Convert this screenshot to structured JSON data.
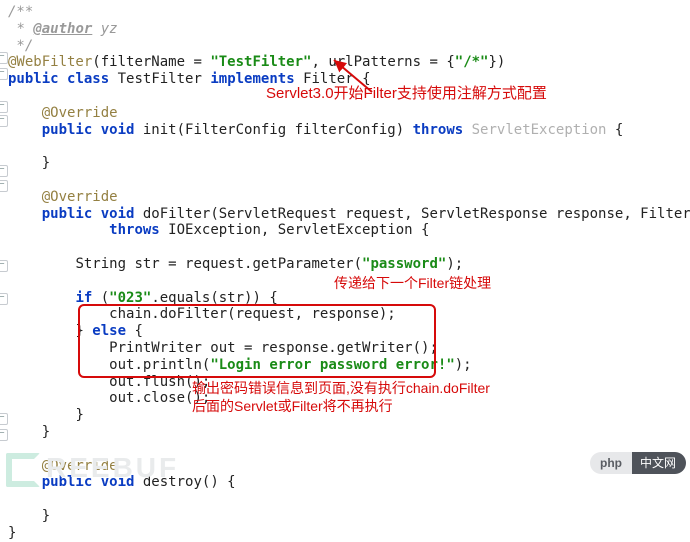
{
  "javadoc": {
    "open": "/**",
    "authorTag": "@author",
    "authorVal": "yz",
    "close": " */"
  },
  "webfilter": {
    "ann": "@WebFilter",
    "args_pre": "(filterName = ",
    "filterName": "\"TestFilter\"",
    "mid": ", urlPatterns = {",
    "pattern": "\"/*\"",
    "post": "})"
  },
  "classLine": {
    "kwPublic": "public",
    "kwClass": "class",
    "name": "TestFilter",
    "kwImpl": "implements",
    "iface": "Filter {"
  },
  "override": "@Override",
  "init": {
    "sig_pre": "public void",
    "name": "init",
    "params": "(FilterConfig filterConfig)",
    "kwThrows": "throws",
    "exc": "ServletException",
    "open": " {"
  },
  "doFilter": {
    "sig_pre": "public void",
    "name": "doFilter",
    "params": "(ServletRequest request, ServletResponse response, FilterChain chain)",
    "kwThrows": "throws",
    "exc": "IOException, ServletException {"
  },
  "bodyStr": {
    "decl": "String str = request.getParameter(",
    "lit": "\"password\"",
    "end": ");"
  },
  "ifLine": {
    "kwIf": "if",
    "pre": " (",
    "lit": "\"023\"",
    "post": ".equals(str)) {"
  },
  "chainCall": "chain.doFilter(request, response);",
  "elseLine": {
    "close": "} ",
    "kwElse": "else",
    "open": " {"
  },
  "pw": {
    "l1a": "PrintWriter out = response.getWriter();",
    "l2a": "out.println(",
    "l2lit": "\"Login error password error!\"",
    "l2b": ");",
    "l3": "out.flush();",
    "l4": "out.close();"
  },
  "closeBrace": "}",
  "destroy": {
    "sig": "public void",
    "name": "destroy",
    "rest": "() {"
  },
  "annos": {
    "a1": "Servlet3.0开始Filter支持使用注解方式配置",
    "a2": "传递给下一个Filter链处理",
    "a3l1": "输出密码错误信息到页面,没有执行chain.doFilter",
    "a3l2": "后面的Servlet或Filter将不再执行"
  },
  "wm": "REEBUF",
  "badge": {
    "left": "php",
    "right": "中文网"
  }
}
